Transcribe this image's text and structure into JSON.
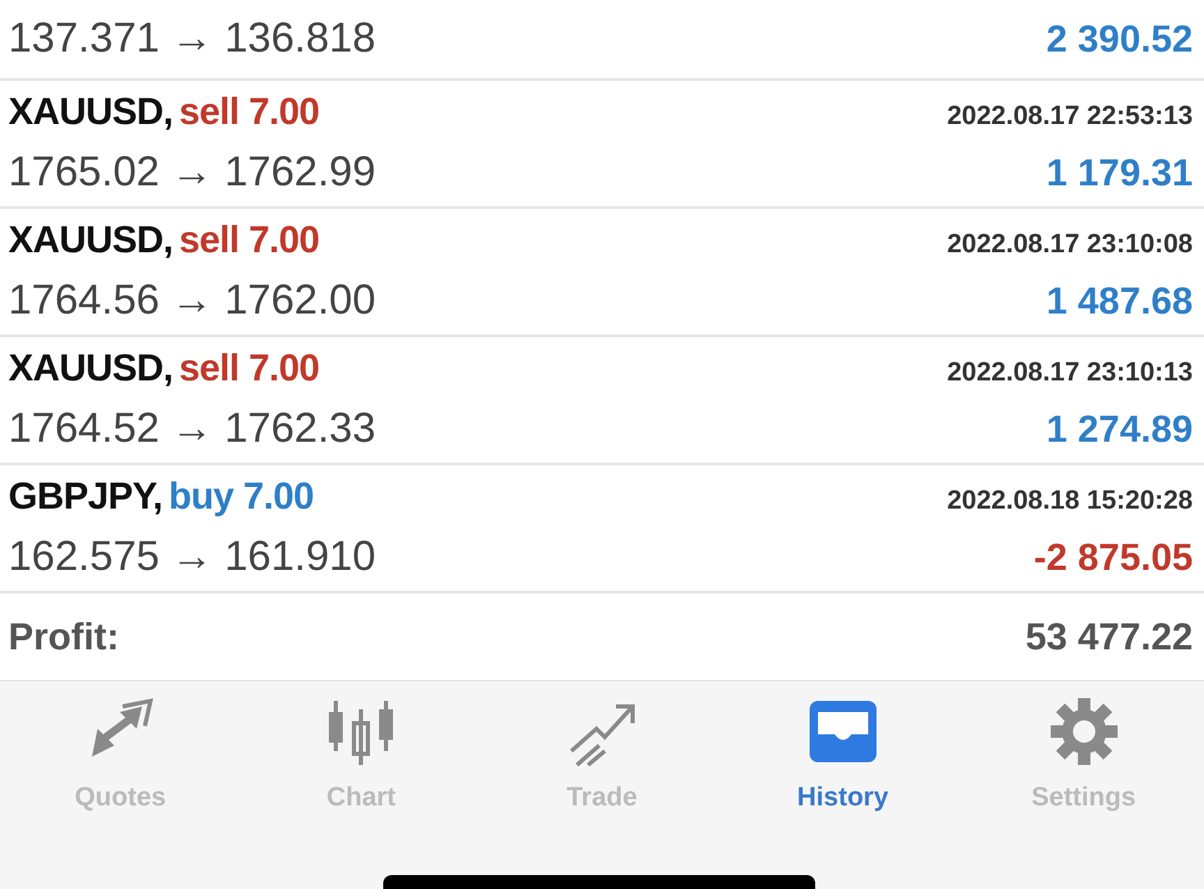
{
  "deals": [
    {
      "prices": "137.371 → 136.818",
      "result": "2 390.52",
      "color": "#2f7fc8"
    },
    {
      "symbol": "XAUUSD,",
      "side": "sell 7.00",
      "kind": "sell",
      "time": "2022.08.17 22:53:13",
      "prices": "1765.02 → 1762.99",
      "result": "1 179.31",
      "color": "#2f7fc8"
    },
    {
      "symbol": "XAUUSD,",
      "side": "sell 7.00",
      "kind": "sell",
      "time": "2022.08.17 23:10:08",
      "prices": "1764.56 → 1762.00",
      "result": "1 487.68",
      "color": "#2f7fc8"
    },
    {
      "symbol": "XAUUSD,",
      "side": "sell 7.00",
      "kind": "sell",
      "time": "2022.08.17 23:10:13",
      "prices": "1764.52 → 1762.33",
      "result": "1 274.89",
      "color": "#2f7fc8"
    },
    {
      "symbol": "GBPJPY,",
      "side": "buy 7.00",
      "kind": "buy",
      "time": "2022.08.18 15:20:28",
      "prices": "162.575 → 161.910",
      "result": "-2 875.05",
      "color": "#c0392b"
    }
  ],
  "summary": {
    "label": "Profit:",
    "value": "53 477.22"
  },
  "tabs": [
    {
      "label": "Quotes",
      "selected": false
    },
    {
      "label": "Chart",
      "selected": false
    },
    {
      "label": "Trade",
      "selected": false
    },
    {
      "label": "History",
      "selected": true
    },
    {
      "label": "Settings",
      "selected": false
    }
  ]
}
